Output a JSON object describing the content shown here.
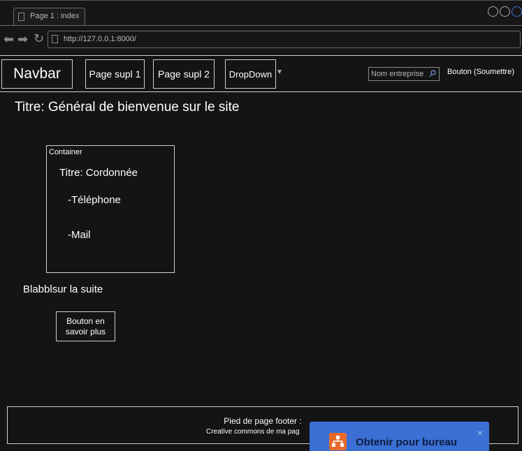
{
  "browser": {
    "tab_title": "Page 1 : index",
    "url": "http://127.0.0.1:8000/"
  },
  "navbar": {
    "brand": "Navbar",
    "links": [
      "Page supl 1",
      "Page supl 2"
    ],
    "dropdown": "DropDown",
    "search_placeholder": "Nom entreprise",
    "submit_label": "Bouton (Soumettre)"
  },
  "main": {
    "title": "Titre: Général de bienvenue sur le site",
    "container": {
      "label": "Container",
      "title": "Titre: Cordonnée",
      "phone": "-Téléphone",
      "mail": "-Mail"
    },
    "blurb": "Blabblsur la suite",
    "more_button": "Bouton en savoir plus"
  },
  "footer": {
    "title": "Pied de page footer :",
    "subtitle": "Creative commons de ma pag"
  },
  "promo": {
    "text": "Obtenir pour bureau",
    "close": "×"
  },
  "colors": {
    "background": "#151414",
    "foreground": "#ffffff",
    "promo_bg": "#3b6fd4",
    "promo_logo": "#e86a2b"
  }
}
